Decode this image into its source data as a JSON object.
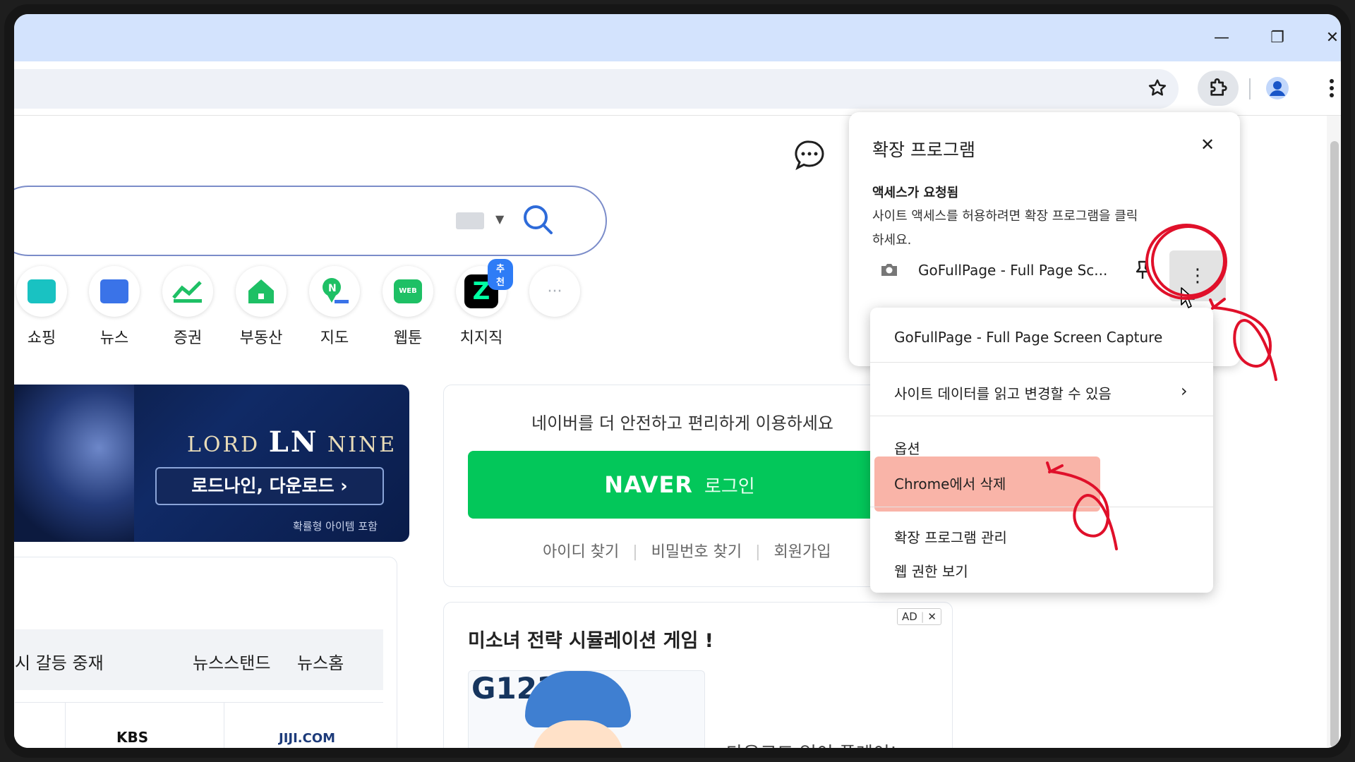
{
  "window": {
    "minimize_glyph": "—",
    "restore_glyph": "❐",
    "close_glyph": "✕"
  },
  "toolbar": {
    "bookmark_icon": "star-icon",
    "extensions_icon": "puzzle-icon",
    "profile_icon": "person-icon",
    "menu_icon": "kebab-icon"
  },
  "naver": {
    "shortcuts": [
      {
        "label": "쇼핑",
        "icon": "shopping-icon",
        "color": "#19c2c2"
      },
      {
        "label": "뉴스",
        "icon": "news-icon",
        "color": "#3a73e8"
      },
      {
        "label": "증권",
        "icon": "stock-icon",
        "color": "#1ec065"
      },
      {
        "label": "부동산",
        "icon": "house-icon",
        "color": "#1ec065"
      },
      {
        "label": "지도",
        "icon": "map-icon",
        "color": "#1ec065"
      },
      {
        "label": "웹툰",
        "icon": "webtoon-icon",
        "color": "#1ec065"
      },
      {
        "label": "치지직",
        "icon": "chzzk-icon",
        "color": "#000000"
      }
    ],
    "recommend_badge": "추천",
    "more_glyph": "···",
    "banner": {
      "title_left": "LORD",
      "title_logo": "LN",
      "title_right": "NINE",
      "cta": "로드나인, 다운로드 ›",
      "sub": "확률형 아이템 포함"
    },
    "login_card": {
      "message": "네이버를 더 안전하고 편리하게 이용하세요",
      "btn_brand": "NAVER",
      "btn_text": "로그인",
      "links": [
        "아이디 찾기",
        "비밀번호 찾기",
        "회원가입"
      ]
    },
    "news_bar": {
      "headline": "시 갈등 중재",
      "links": [
        "뉴스스탠드",
        "뉴스홈"
      ]
    },
    "press_logos": [
      "KBS",
      "JIJI.COM"
    ],
    "ad_card": {
      "ad_label": "AD",
      "ad_close": "✕",
      "title": "미소녀 전략 시뮬레이션 게임 !",
      "brand": "G123",
      "tagline": "다운로드 없이 플레이!"
    }
  },
  "extensions_popup": {
    "title": "확장 프로그램",
    "close_glyph": "✕",
    "section_title": "액세스가 요청됨",
    "section_desc_1": "사이트 액세스를 허용하려면 확장 프로그램을 클릭",
    "section_desc_2": "하세요.",
    "item_name": "GoFullPage - Full Page Sc...",
    "pin_glyph": "⊥",
    "more_glyph": "⋮"
  },
  "context_menu": {
    "items": [
      "GoFullPage - Full Page Screen Capture",
      "사이트 데이터를 읽고 변경할 수 있음",
      "옵션",
      "Chrome에서 삭제",
      "확장 프로그램 관리",
      "웹 권한 보기"
    ],
    "submenu_glyph": "›",
    "highlight_color": "#f9b4a8"
  }
}
